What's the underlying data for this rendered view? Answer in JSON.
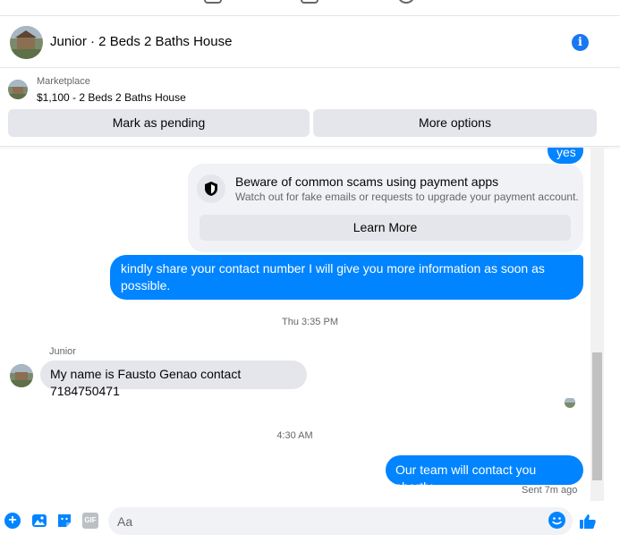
{
  "conversation": {
    "title": "Junior · 2 Beds 2 Baths House"
  },
  "marketplace": {
    "label": "Marketplace",
    "listing": "$1,100 - 2 Beds 2 Baths House",
    "mark_pending_label": "Mark as pending",
    "more_options_label": "More options"
  },
  "messages": {
    "yes_text": "yes",
    "scam_title": "Beware of common scams using payment apps",
    "scam_body": "Watch out for fake emails or requests to upgrade your payment account.",
    "learn_more_label": "Learn More",
    "share_text": "kindly share your contact number I will give you more information as soon as possible.",
    "timestamp_1": "Thu 3:35 PM",
    "sender_name": "Junior",
    "fausto_text": "My name is Fausto Genao contact 7184750471",
    "timestamp_2": "4:30 AM",
    "team_text": "Our team will contact you shortly.",
    "sent_status": "Sent 7m ago"
  },
  "composer": {
    "placeholder": "Aa",
    "gif_label": "GIF"
  },
  "colors": {
    "accent": "#0084ff",
    "info": "#1877f2",
    "bubble_in": "#e4e6eb"
  },
  "icons": [
    "info-icon",
    "shield-icon",
    "plus-icon",
    "photo-icon",
    "sticker-icon",
    "gif-icon",
    "emoji-icon",
    "like-icon"
  ]
}
